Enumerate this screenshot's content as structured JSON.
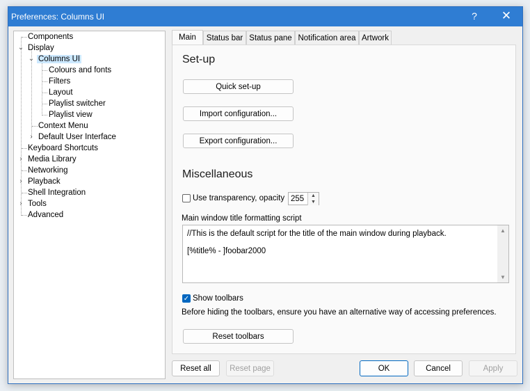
{
  "window": {
    "title": "Preferences: Columns UI",
    "help_label": "?",
    "close_label": "✕"
  },
  "tree": {
    "items": [
      {
        "label": "Components"
      },
      {
        "label": "Display",
        "expander": "⌄"
      },
      {
        "label": "Columns UI",
        "expander": "⌄",
        "selected": true
      },
      {
        "label": "Colours and fonts"
      },
      {
        "label": "Filters"
      },
      {
        "label": "Layout"
      },
      {
        "label": "Playlist switcher"
      },
      {
        "label": "Playlist view"
      },
      {
        "label": "Context Menu"
      },
      {
        "label": "Default User Interface",
        "expander": "›"
      },
      {
        "label": "Keyboard Shortcuts"
      },
      {
        "label": "Media Library",
        "expander": "›"
      },
      {
        "label": "Networking"
      },
      {
        "label": "Playback",
        "expander": "›"
      },
      {
        "label": "Shell Integration"
      },
      {
        "label": "Tools",
        "expander": "›"
      },
      {
        "label": "Advanced"
      }
    ]
  },
  "tabs": [
    {
      "label": "Main",
      "active": true
    },
    {
      "label": "Status bar"
    },
    {
      "label": "Status pane"
    },
    {
      "label": "Notification area"
    },
    {
      "label": "Artwork"
    }
  ],
  "main": {
    "setup_heading": "Set-up",
    "quick_setup": "Quick set-up",
    "import_config": "Import configuration...",
    "export_config": "Export configuration...",
    "misc_heading": "Miscellaneous",
    "use_transparency_label": "Use transparency, opacity",
    "use_transparency_checked": false,
    "opacity_value": "255",
    "script_label": "Main window title formatting script",
    "script_lines": [
      "//This is the default script for the title of the main window during playback.",
      "[%title% - ]foobar2000"
    ],
    "show_toolbars_label": "Show toolbars",
    "show_toolbars_checked": true,
    "toolbars_note": "Before hiding the toolbars, ensure you have an alternative way of accessing preferences.",
    "reset_toolbars": "Reset toolbars"
  },
  "footer": {
    "reset_all": "Reset all",
    "reset_page": "Reset page",
    "ok": "OK",
    "cancel": "Cancel",
    "apply": "Apply"
  },
  "colors": {
    "titlebar": "#2f7dd3",
    "accent": "#0067c0",
    "selection": "#cce8ff"
  },
  "icons": {
    "help": "help-icon",
    "close": "close-icon",
    "expander_open": "chevron-down-icon",
    "expander_closed": "chevron-right-icon",
    "spin_up": "spin-up-icon",
    "spin_down": "spin-down-icon"
  }
}
